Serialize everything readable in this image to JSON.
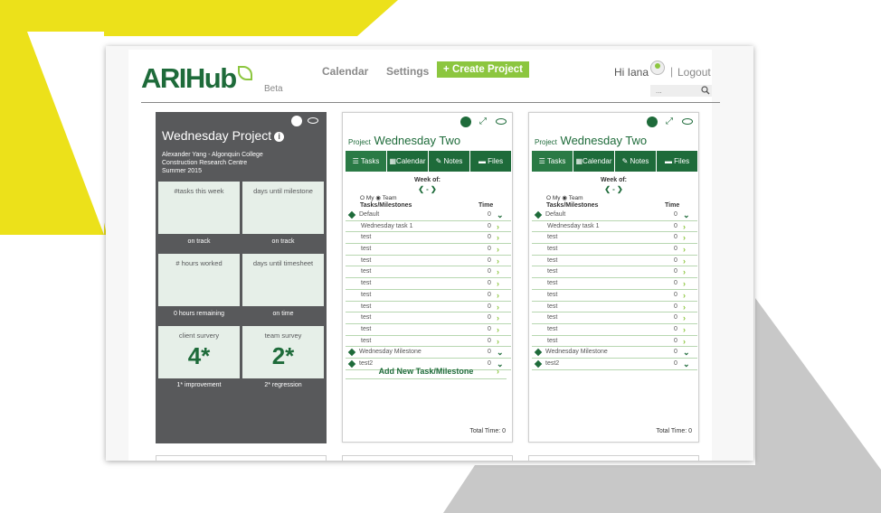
{
  "colors": {
    "brand_green": "#1e6b3a",
    "accent_green": "#8cc63f",
    "dark_card": "#58595b",
    "tile_bg": "#e6efe8",
    "deco_yellow": "#ece11a",
    "deco_grey": "#c8c8c8"
  },
  "header": {
    "logo": "ARIHub",
    "beta": "Beta",
    "nav": {
      "calendar": "Calendar",
      "settings": "Settings"
    },
    "create_button": "+ Create Project",
    "greeting": "Hi Iana",
    "separator": "|",
    "logout": "Logout",
    "search_placeholder": "..."
  },
  "dashboard": {
    "title": "Wednesday Project",
    "info_glyph": "i",
    "meta": [
      "Alexander Yang - Algonquin College",
      "Construction Research Centre",
      "Summer 2015"
    ],
    "tiles": [
      {
        "label": "#tasks this week",
        "value": "",
        "caption": "on track"
      },
      {
        "label": "days until milestone",
        "value": "",
        "caption": "on track"
      },
      {
        "label": "# hours worked",
        "value": "",
        "caption": "0 hours remaining"
      },
      {
        "label": "days until timesheet",
        "value": "",
        "caption": "on time"
      },
      {
        "label": "client survery",
        "value": "4*",
        "caption": "1* improvement"
      },
      {
        "label": "team survey",
        "value": "2*",
        "caption": "2* regression"
      }
    ]
  },
  "project_cards": [
    {
      "prefix": "Project",
      "title": "Wednesday Two",
      "tabs": [
        "Tasks",
        "Calendar",
        "Notes",
        "Files"
      ],
      "week_of": "Week of:",
      "week_nav": "❮ - ❯",
      "radio": "O My ◉ Team",
      "col_tasks": "Tasks/Milestones",
      "col_time": "Time",
      "rows": [
        {
          "name": "Default",
          "time": "0",
          "milestone": true
        },
        {
          "name": "Wednesday task 1",
          "time": "0",
          "milestone": false
        },
        {
          "name": "test",
          "time": "0",
          "milestone": false
        },
        {
          "name": "test",
          "time": "0",
          "milestone": false
        },
        {
          "name": "test",
          "time": "0",
          "milestone": false
        },
        {
          "name": "test",
          "time": "0",
          "milestone": false
        },
        {
          "name": "test",
          "time": "0",
          "milestone": false
        },
        {
          "name": "test",
          "time": "0",
          "milestone": false
        },
        {
          "name": "test",
          "time": "0",
          "milestone": false
        },
        {
          "name": "test",
          "time": "0",
          "milestone": false
        },
        {
          "name": "test",
          "time": "0",
          "milestone": false
        },
        {
          "name": "test",
          "time": "0",
          "milestone": false
        },
        {
          "name": "Wednesday Milestone",
          "time": "0",
          "milestone": true
        },
        {
          "name": "test2",
          "time": "0",
          "milestone": true
        }
      ],
      "add_new": "Add New Task/Milestone",
      "total": "Total Time: 0"
    },
    {
      "prefix": "Project",
      "title": "Wednesday Two",
      "tabs": [
        "Tasks",
        "Calendar",
        "Notes",
        "Files"
      ],
      "week_of": "Week of:",
      "week_nav": "❮ - ❯",
      "radio": "O My ◉ Team",
      "col_tasks": "Tasks/Milestones",
      "col_time": "Time",
      "rows": [
        {
          "name": "Default",
          "time": "0",
          "milestone": true
        },
        {
          "name": "Wednesday task 1",
          "time": "0",
          "milestone": false
        },
        {
          "name": "test",
          "time": "0",
          "milestone": false
        },
        {
          "name": "test",
          "time": "0",
          "milestone": false
        },
        {
          "name": "test",
          "time": "0",
          "milestone": false
        },
        {
          "name": "test",
          "time": "0",
          "milestone": false
        },
        {
          "name": "test",
          "time": "0",
          "milestone": false
        },
        {
          "name": "test",
          "time": "0",
          "milestone": false
        },
        {
          "name": "test",
          "time": "0",
          "milestone": false
        },
        {
          "name": "test",
          "time": "0",
          "milestone": false
        },
        {
          "name": "test",
          "time": "0",
          "milestone": false
        },
        {
          "name": "test",
          "time": "0",
          "milestone": false
        },
        {
          "name": "Wednesday Milestone",
          "time": "0",
          "milestone": true
        },
        {
          "name": "test2",
          "time": "0",
          "milestone": true
        }
      ],
      "add_new": "",
      "total": "Total Time: 0"
    }
  ]
}
